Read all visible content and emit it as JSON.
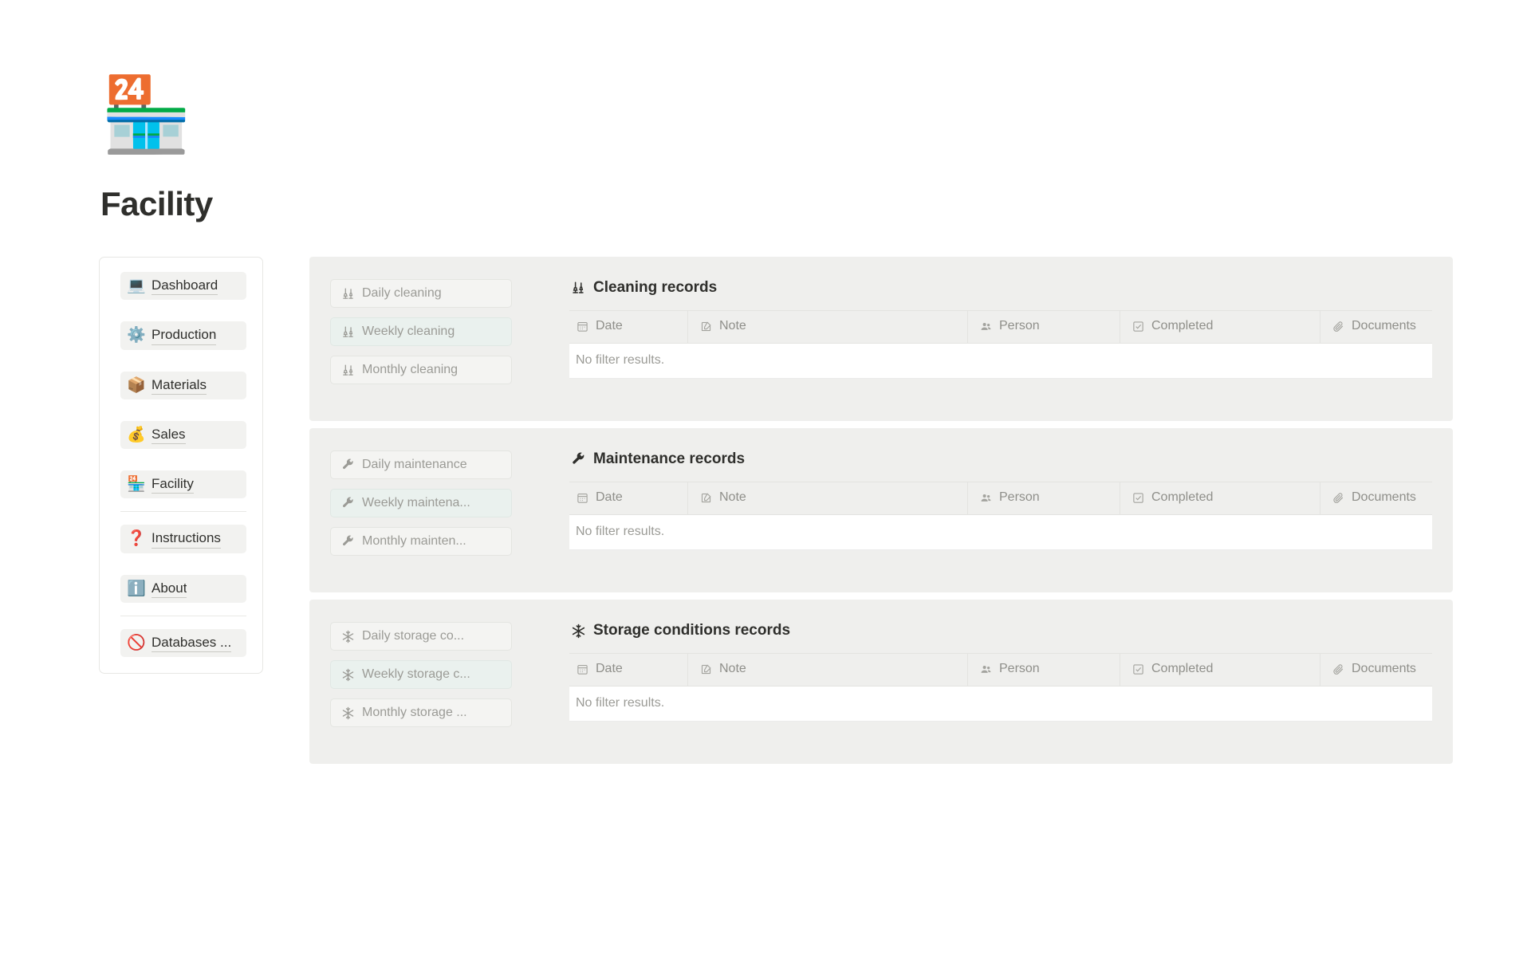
{
  "header": {
    "emoji": "🏪",
    "emoji_name": "convenience-store-emoji",
    "title": "Facility"
  },
  "sidebar": {
    "items": [
      {
        "emoji": "💻",
        "icon_name": "laptop-icon",
        "label": "Dashboard"
      },
      {
        "emoji": "⚙️",
        "icon_name": "gear-icon",
        "label": "Production"
      },
      {
        "emoji": "📦",
        "icon_name": "package-icon",
        "label": "Materials"
      },
      {
        "emoji": "💰",
        "icon_name": "money-bag-icon",
        "label": "Sales"
      },
      {
        "emoji": "🏪",
        "icon_name": "convenience-store-icon",
        "label": "Facility"
      },
      {
        "emoji": "❓",
        "icon_name": "question-mark-icon",
        "label": "Instructions"
      },
      {
        "emoji": "ℹ️",
        "icon_name": "information-icon",
        "label": "About"
      },
      {
        "emoji": "🚫",
        "icon_name": "prohibited-icon",
        "label": "Databases ..."
      }
    ]
  },
  "columns": [
    {
      "label": "Date",
      "icon": "calendar-icon"
    },
    {
      "label": "Note",
      "icon": "edit-pencil-icon"
    },
    {
      "label": "Person",
      "icon": "people-icon"
    },
    {
      "label": "Completed",
      "icon": "checkbox-icon"
    },
    {
      "label": "Documents",
      "icon": "paperclip-icon"
    }
  ],
  "empty_message": "No filter results.",
  "panels": [
    {
      "icon": "broom-icon",
      "title": "Cleaning records",
      "filters": [
        {
          "label": "Daily cleaning",
          "tinted": false
        },
        {
          "label": "Weekly cleaning",
          "tinted": true
        },
        {
          "label": "Monthly cleaning",
          "tinted": false
        }
      ]
    },
    {
      "icon": "wrench-icon",
      "title": "Maintenance records",
      "filters": [
        {
          "label": "Daily maintenance",
          "tinted": false
        },
        {
          "label": "Weekly maintena...",
          "tinted": true
        },
        {
          "label": "Monthly mainten...",
          "tinted": false
        }
      ]
    },
    {
      "icon": "snowflake-icon",
      "title": "Storage conditions records",
      "filters": [
        {
          "label": "Daily storage co...",
          "tinted": false
        },
        {
          "label": "Weekly storage c...",
          "tinted": true
        },
        {
          "label": "Monthly storage ...",
          "tinted": false
        }
      ]
    }
  ],
  "colors": {
    "page_background": "#ffffff",
    "panel_background": "#efefed",
    "nav_pill_background": "#f2f2f0",
    "tinted_filter_background": "#eaf1ee",
    "muted_text": "#9b9b96",
    "primary_text": "#2f2f2c"
  }
}
